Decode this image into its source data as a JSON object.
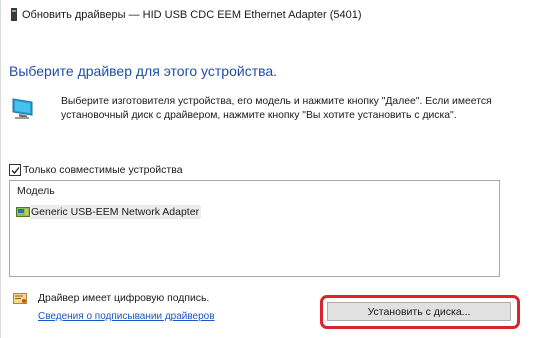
{
  "window": {
    "title": "Обновить драйверы — HID USB CDC EEM Ethernet Adapter (5401)"
  },
  "heading": "Выберите драйвер для этого устройства.",
  "info": {
    "text": "Выберите изготовителя устройства, его модель и нажмите кнопку \"Далее\". Если имеется установочный диск с драйвером, нажмите кнопку \"Вы хотите установить с диска\"."
  },
  "compatible": {
    "label": "Только совместимые устройства",
    "checked": true
  },
  "list": {
    "column_header": "Модель",
    "items": [
      {
        "label": "Generic USB-EEM Network Adapter",
        "icon": "network-adapter-icon"
      }
    ]
  },
  "signature": {
    "text": "Драйвер имеет цифровую подпись.",
    "link": "Сведения о подписывании драйверов"
  },
  "buttons": {
    "have_disk": "Установить с диска..."
  },
  "colors": {
    "heading": "#1f4ea8",
    "link": "#1a56c4",
    "highlight": "#d8242a"
  }
}
